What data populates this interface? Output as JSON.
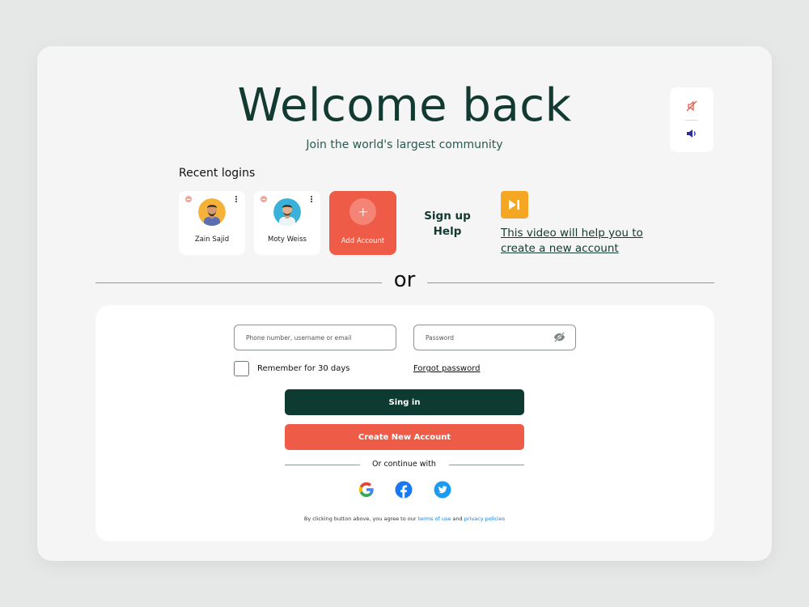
{
  "header": {
    "title": "Welcome back",
    "subtitle": "Join the world's largest community"
  },
  "recent": {
    "label": "Recent logins",
    "accounts": [
      {
        "name": "Zain Sajid"
      },
      {
        "name": "Moty Weiss"
      }
    ],
    "add_label": "Add Account"
  },
  "help": {
    "signup_help": "Sign up Help",
    "video_link": "This video will help you to create a new account"
  },
  "divider": {
    "or": "or"
  },
  "form": {
    "username_placeholder": "Phone number, username or email",
    "password_placeholder": "Password",
    "remember_label": "Remember for 30 days",
    "forgot_label": "Forgot password",
    "signin_label": "Sing in",
    "create_label": "Create New Account",
    "continue_with": "Or continue with",
    "terms_prefix": "By clicking button above, you agree to our ",
    "terms_link": "terms of use",
    "terms_and": " and ",
    "privacy_link": "privacy policies"
  },
  "icons": {
    "sound_panel": [
      "mute-icon",
      "volume-icon"
    ],
    "social": [
      "google-icon",
      "facebook-icon",
      "twitter-icon"
    ],
    "video": "play-skip-icon",
    "password_toggle": "eye-off-icon"
  },
  "colors": {
    "primary_dark": "#0d3a31",
    "accent_coral": "#ee5b47",
    "video_orange": "#f5a623",
    "link_blue": "#1f7fcf"
  }
}
